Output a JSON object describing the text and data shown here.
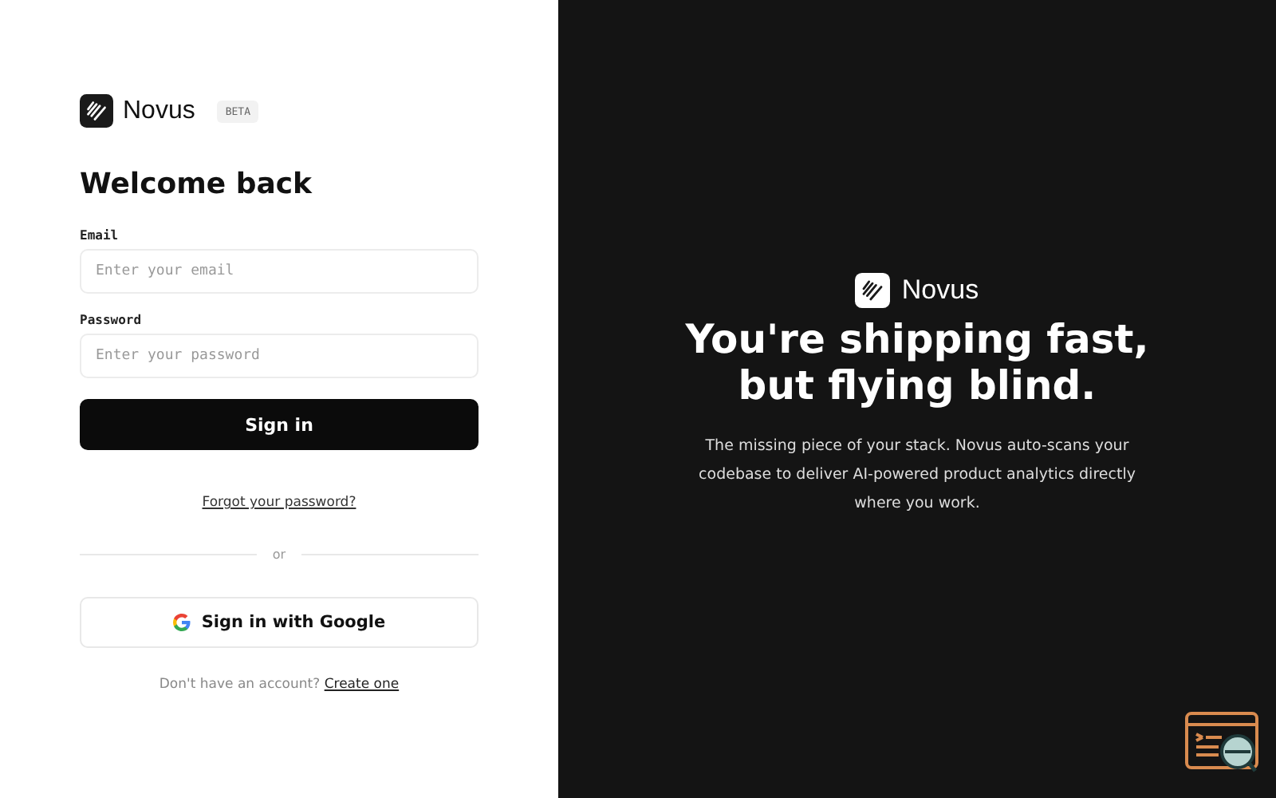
{
  "brand": {
    "name": "Novus",
    "badge": "BETA"
  },
  "heading": "Welcome back",
  "fields": [
    {
      "label": "Email",
      "placeholder": "Enter your email"
    },
    {
      "label": "Password",
      "placeholder": "Enter your password"
    }
  ],
  "sign_in_button": "Sign in",
  "forgot_link": "Forgot your password?",
  "divider_text": "or",
  "google_button": "Sign in with Google",
  "signup": {
    "text": "Don't have an account?",
    "link": "Create one"
  },
  "hero": {
    "brand": "Novus",
    "title_lines": [
      "You're shipping fast,",
      "but flying blind."
    ],
    "body": "The missing piece of your stack. Novus auto-scans your codebase to deliver AI-powered product analytics directly where you work."
  }
}
